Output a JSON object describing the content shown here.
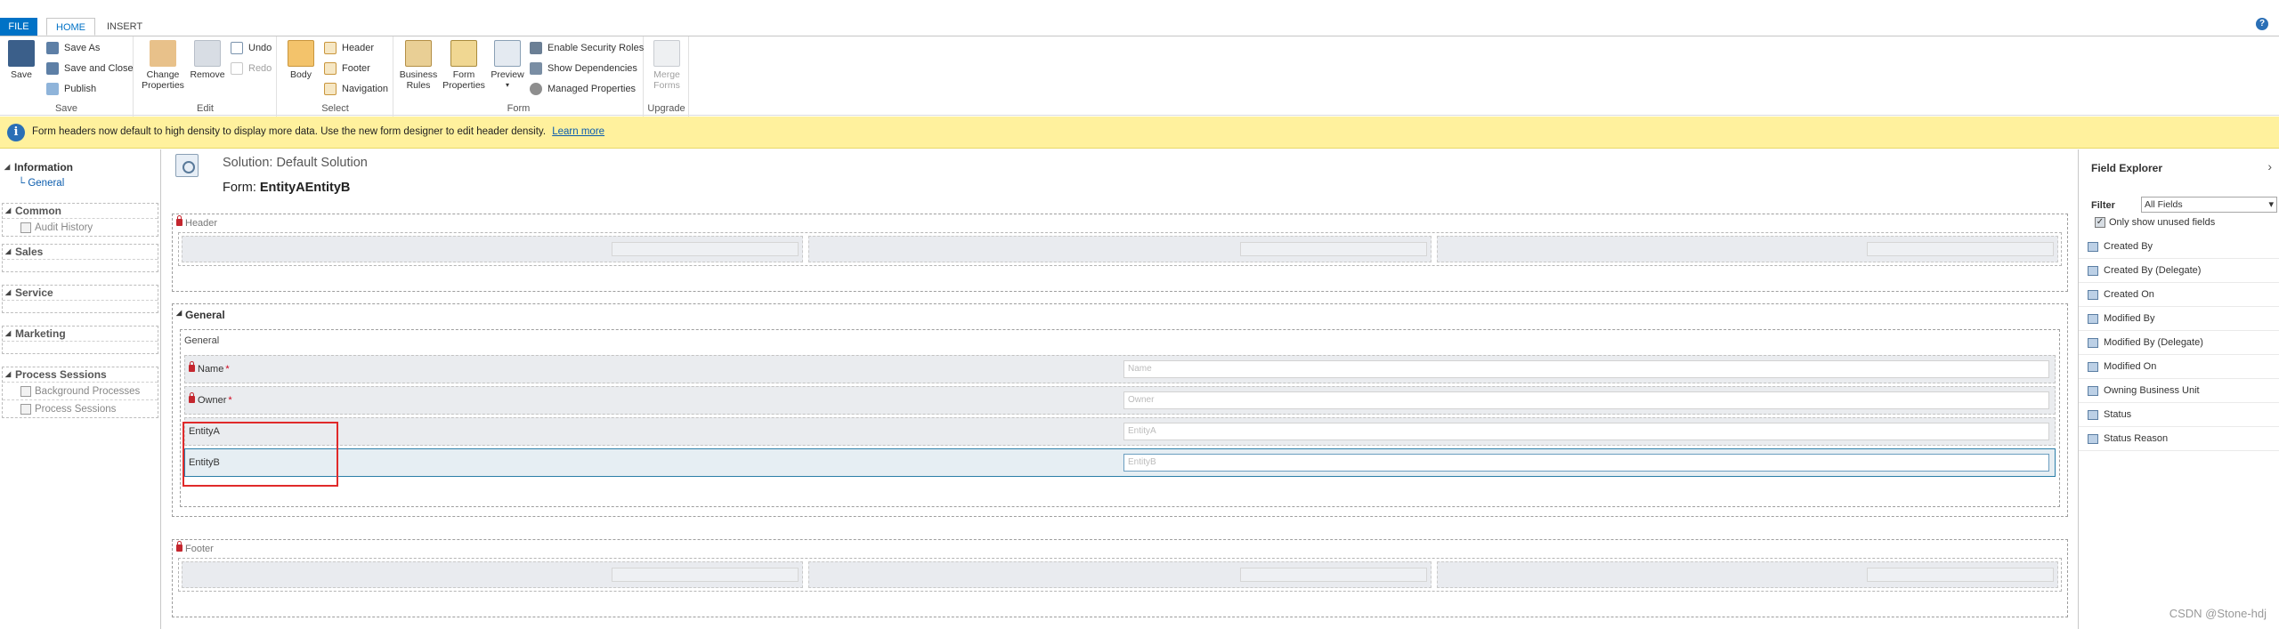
{
  "tabs": {
    "file": "FILE",
    "home": "HOME",
    "insert": "INSERT"
  },
  "help_icon": "?",
  "ribbon": {
    "save_group": {
      "label": "Save",
      "save": "Save",
      "save_as": "Save As",
      "save_and_close": "Save and Close",
      "publish": "Publish"
    },
    "edit_group": {
      "label": "Edit",
      "change_properties": "Change Properties",
      "remove": "Remove",
      "undo": "Undo",
      "redo": "Redo"
    },
    "select_group": {
      "label": "Select",
      "body": "Body",
      "header": "Header",
      "footer": "Footer",
      "navigation": "Navigation"
    },
    "form_group": {
      "label": "Form",
      "business_rules": "Business Rules",
      "form_properties": "Form Properties",
      "preview": "Preview",
      "enable_security_roles": "Enable Security Roles",
      "show_dependencies": "Show Dependencies",
      "managed_properties": "Managed Properties"
    },
    "upgrade_group": {
      "label": "Upgrade",
      "merge_forms": "Merge Forms"
    }
  },
  "notification": {
    "icon": "i",
    "text": "Form headers now default to high density to display more data. Use the new form designer to edit header density.",
    "link": "Learn more"
  },
  "nav": {
    "information": {
      "label": "Information",
      "items": [
        "General"
      ]
    },
    "common": {
      "label": "Common",
      "items": [
        "Audit History"
      ]
    },
    "sales": {
      "label": "Sales"
    },
    "service": {
      "label": "Service"
    },
    "marketing": {
      "label": "Marketing"
    },
    "process_sessions": {
      "label": "Process Sessions",
      "items": [
        "Background Processes",
        "Process Sessions"
      ]
    }
  },
  "form": {
    "solution": "Solution: Default Solution",
    "form_prefix": "Form:",
    "form_name": "EntityAEntityB",
    "header_label": "Header",
    "footer_label": "Footer",
    "tab_label": "General",
    "section_label": "General",
    "fields": [
      {
        "label": "Name",
        "required": "*",
        "placeholder": "Name"
      },
      {
        "label": "Owner",
        "required": "*",
        "placeholder": "Owner"
      },
      {
        "label": "EntityA",
        "placeholder": "EntityA"
      },
      {
        "label": "EntityB",
        "placeholder": "EntityB"
      }
    ]
  },
  "explorer": {
    "title": "Field Explorer",
    "collapse_icon": "›",
    "filter_label": "Filter",
    "filter_value": "All Fields",
    "check_mark": "✓",
    "only_unused_label": "Only show unused fields",
    "fields": [
      "Created By",
      "Created By (Delegate)",
      "Created On",
      "Modified By",
      "Modified By (Delegate)",
      "Modified On",
      "Owning Business Unit",
      "Status",
      "Status Reason"
    ]
  },
  "watermark": "CSDN @Stone-hdj",
  "colors": {
    "accent": "#0072c6",
    "notice_bg": "#fff19d",
    "highlight": "#e02a2a"
  }
}
